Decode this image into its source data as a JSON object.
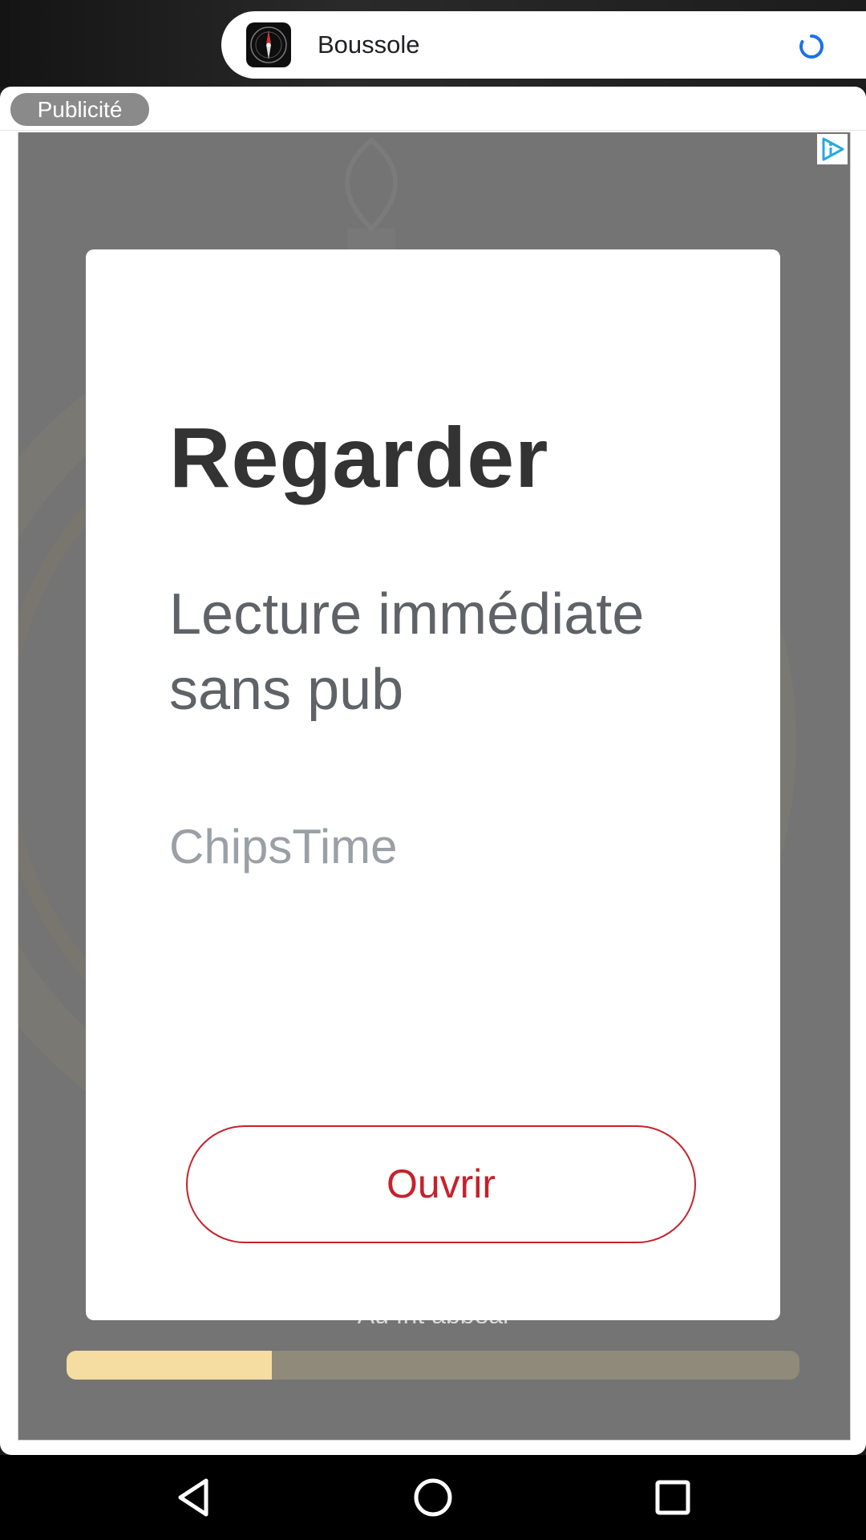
{
  "app_bar": {
    "app_name": "Boussole",
    "icon": "compass-icon",
    "status_icon": "loading-spinner-icon"
  },
  "ad": {
    "label": "Publicité",
    "adchoices_icon": "adchoices-icon",
    "card": {
      "title": "Regarder",
      "subtitle": "Lecture immédiate sans pub",
      "brand": "ChipsTime",
      "cta_label": "Ouvrir"
    },
    "under_text": "Au frit appeal",
    "progress_fraction": 0.28
  },
  "nav": {
    "back_icon": "back-triangle-icon",
    "home_icon": "home-circle-icon",
    "recents_icon": "recents-square-icon"
  },
  "colors": {
    "cta": "#c5222b",
    "progress_fill": "#f5dca0",
    "spinner": "#1a73e8"
  }
}
